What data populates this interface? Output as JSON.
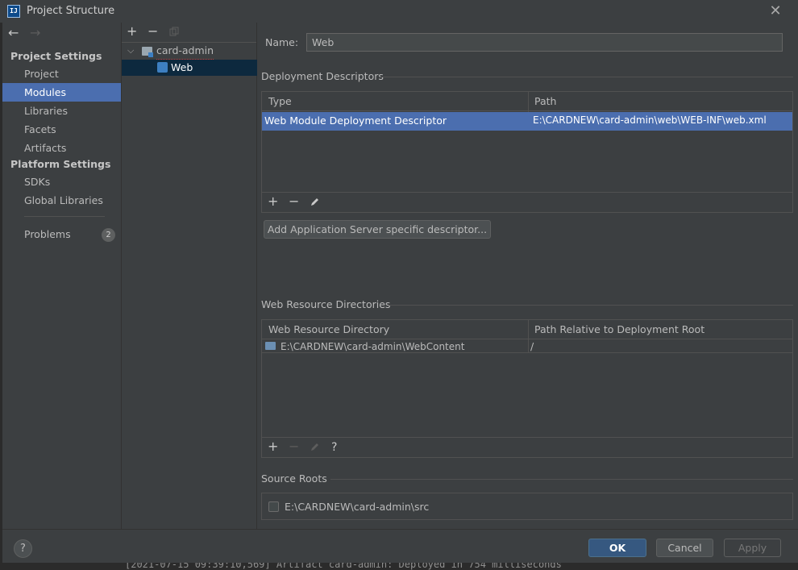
{
  "window": {
    "title": "Project Structure"
  },
  "nav": {
    "back": "←",
    "forward": "→",
    "project_settings_header": "Project Settings",
    "project_items": [
      "Project",
      "Modules",
      "Libraries",
      "Facets",
      "Artifacts"
    ],
    "selected": "Modules",
    "platform_settings_header": "Platform Settings",
    "platform_items": [
      "SDKs",
      "Global Libraries"
    ],
    "problems_label": "Problems",
    "problems_count": "2"
  },
  "tree": {
    "add": "+",
    "remove": "−",
    "copy_icon": "copy-icon",
    "module": "card-admin",
    "facet": "Web"
  },
  "detail": {
    "name_label": "Name:",
    "name_value": "Web",
    "deployment": {
      "title": "Deployment Descriptors",
      "columns": [
        "Type",
        "Path"
      ],
      "rows": [
        {
          "type": "Web Module Deployment Descriptor",
          "path": "E:\\CARDNEW\\card-admin\\web\\WEB-INF\\web.xml"
        }
      ],
      "toolbar": [
        "+",
        "−",
        "edit-icon"
      ],
      "add_server_btn": "Add Application Server specific descriptor..."
    },
    "resources": {
      "title": "Web Resource Directories",
      "columns": [
        "Web Resource Directory",
        "Path Relative to Deployment Root"
      ],
      "rows": [
        {
          "dir": "E:\\CARDNEW\\card-admin\\WebContent",
          "rel": "/"
        }
      ],
      "toolbar": [
        "+",
        "−",
        "edit-icon",
        "?"
      ]
    },
    "source_roots": {
      "title": "Source Roots",
      "items": [
        {
          "path": "E:\\CARDNEW\\card-admin\\src",
          "checked": false
        }
      ]
    }
  },
  "footer": {
    "help": "?",
    "ok": "OK",
    "cancel": "Cancel",
    "apply": "Apply"
  },
  "console": {
    "text": "[2021-07-15 09:39:10,569] Artifact card-admin: Deployed in 754 milliseconds"
  },
  "colors": {
    "selection": "#4b6eaf",
    "panel": "#3c3f41",
    "primary_button": "#365880"
  }
}
